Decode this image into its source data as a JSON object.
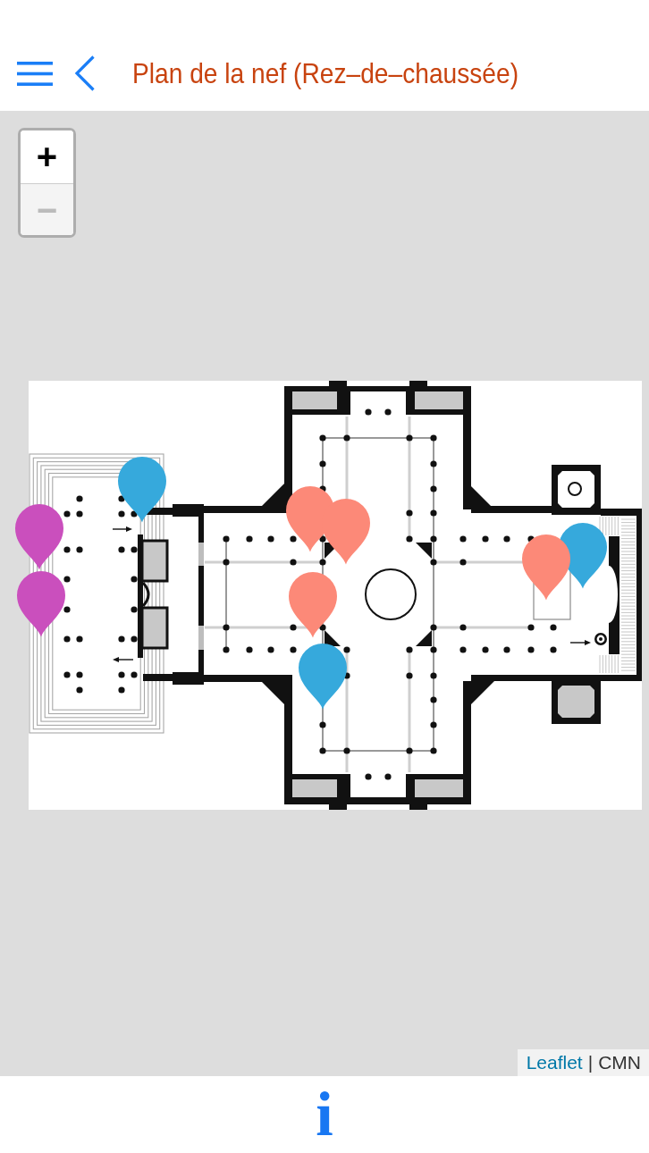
{
  "header": {
    "title": "Plan de la nef (Rez–de–chaussée)"
  },
  "map": {
    "zoom_in": {
      "label": "+",
      "disabled": false
    },
    "zoom_out": {
      "label": "−",
      "disabled": true
    },
    "markers": [
      {
        "color": "#36a9dc"
      },
      {
        "color": "#fc8978"
      },
      {
        "color": "#fc8978"
      },
      {
        "color": "#ca4fbd"
      },
      {
        "color": "#36a9dc"
      },
      {
        "color": "#fc8978"
      },
      {
        "color": "#ca4fbd"
      },
      {
        "color": "#fc8978"
      },
      {
        "color": "#36a9dc"
      }
    ],
    "attribution": {
      "link": "Leaflet",
      "separator": "|",
      "source": "CMN"
    }
  },
  "bottom_bar": {
    "info_button": {
      "label": "i"
    }
  }
}
